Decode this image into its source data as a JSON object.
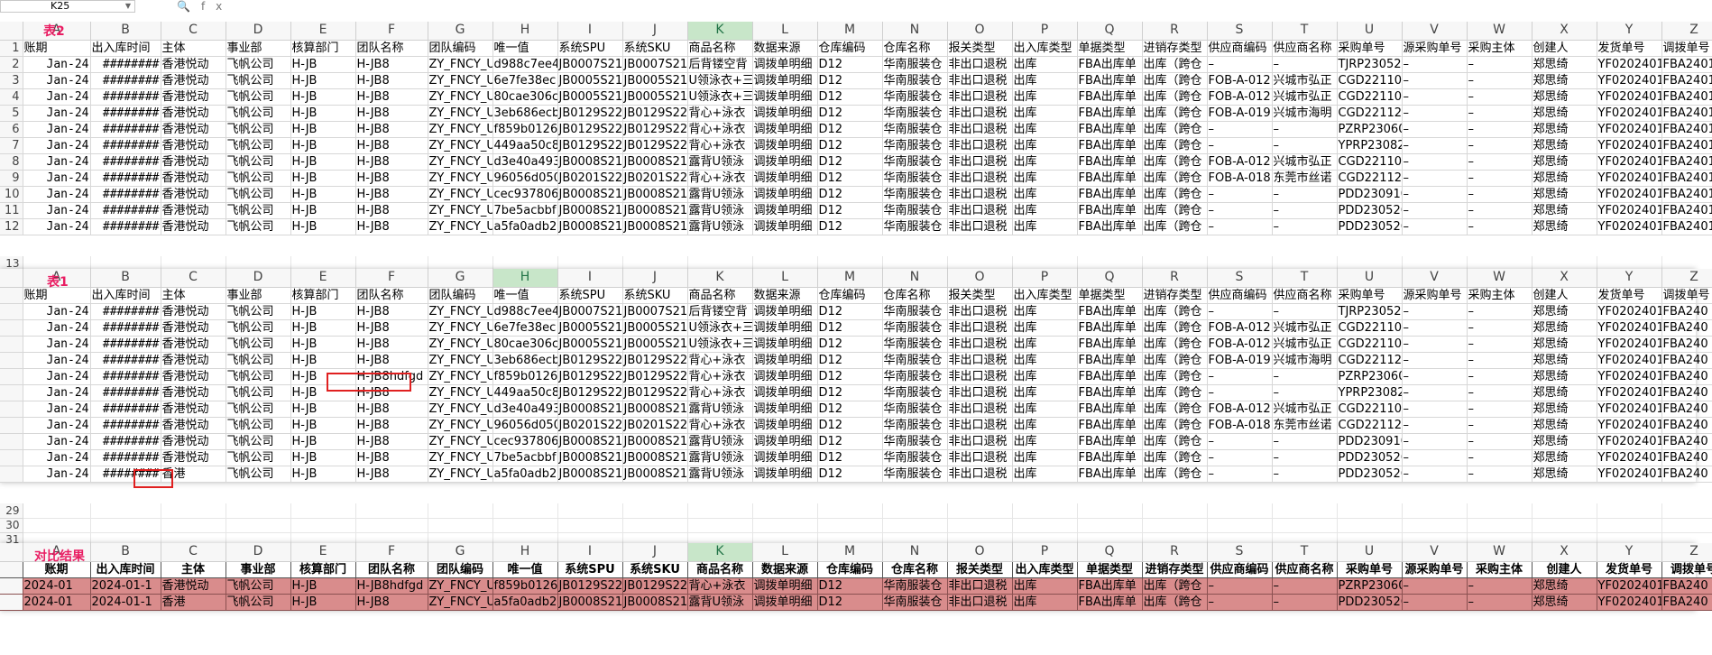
{
  "name_box": "K25",
  "formula_icons": "fx",
  "columns": [
    "A",
    "B",
    "C",
    "D",
    "E",
    "F",
    "G",
    "H",
    "I",
    "J",
    "K",
    "L",
    "M",
    "N",
    "O",
    "P",
    "Q",
    "R",
    "S",
    "T",
    "U",
    "V",
    "W",
    "X",
    "Y",
    "Z"
  ],
  "headers": [
    "账期",
    "出入库时间",
    "主体",
    "事业部",
    "核算部门",
    "团队名称",
    "团队编码",
    "唯一值",
    "系统SPU",
    "系统SKU",
    "商品名称",
    "数据来源",
    "仓库编码",
    "仓库名称",
    "报关类型",
    "出入库类型",
    "单据类型",
    "进销存类型",
    "供应商编码",
    "供应商名称",
    "采购单号",
    "源采购单号",
    "采购主体",
    "创建人",
    "发货单号",
    "调拨单号"
  ],
  "sheet2": {
    "label": "表2",
    "rows": [
      [
        "Jan-24",
        "########",
        "香港悦动",
        "飞帆公司",
        "H-JB",
        "H-JB8",
        "ZY_FNCY_U",
        "d988c7ee4",
        "JB0007S21",
        "JB0007S21",
        "后背镂空背",
        "调拨单明细",
        "D12",
        "华南服装仓",
        "非出口退税",
        "出库",
        "FBA出库单",
        "出库（跨仓",
        "–",
        "–",
        "TJRP23052",
        "–",
        "–",
        "郑思绮",
        "YF0202401",
        "FBA24011"
      ],
      [
        "Jan-24",
        "########",
        "香港悦动",
        "飞帆公司",
        "H-JB",
        "H-JB8",
        "ZY_FNCY_U",
        "6e7fe38ec",
        "JB0005S21",
        "JB0005S21",
        "U领泳衣+三",
        "调拨单明细",
        "D12",
        "华南服装仓",
        "非出口退税",
        "出库",
        "FBA出库单",
        "出库（跨仓",
        "FOB-A-012",
        "兴城市弘正",
        "CGD221103",
        "–",
        "–",
        "郑思绮",
        "YF0202401",
        "FBA24011"
      ],
      [
        "Jan-24",
        "########",
        "香港悦动",
        "飞帆公司",
        "H-JB",
        "H-JB8",
        "ZY_FNCY_U",
        "80cae306c",
        "JB0005S21",
        "JB0005S21",
        "U领泳衣+三",
        "调拨单明细",
        "D12",
        "华南服装仓",
        "非出口退税",
        "出库",
        "FBA出库单",
        "出库（跨仓",
        "FOB-A-012",
        "兴城市弘正",
        "CGD221103",
        "–",
        "–",
        "郑思绮",
        "YF0202401",
        "FBA24011"
      ],
      [
        "Jan-24",
        "########",
        "香港悦动",
        "飞帆公司",
        "H-JB",
        "H-JB8",
        "ZY_FNCY_U",
        "3eb686ecb",
        "JB0129S22",
        "JB0129S22",
        "背心+泳衣",
        "调拨单明细",
        "D12",
        "华南服装仓",
        "非出口退税",
        "出库",
        "FBA出库单",
        "出库（跨仓",
        "FOB-A-019",
        "兴城市海明",
        "CGD221123",
        "–",
        "–",
        "郑思绮",
        "YF0202401",
        "FBA24011"
      ],
      [
        "Jan-24",
        "########",
        "香港悦动",
        "飞帆公司",
        "H-JB",
        "H-JB8",
        "ZY_FNCY_U",
        "f859b0126",
        "JB0129S22",
        "JB0129S22",
        "背心+泳衣",
        "调拨单明细",
        "D12",
        "华南服装仓",
        "非出口退税",
        "出库",
        "FBA出库单",
        "出库（跨仓",
        "–",
        "–",
        "PZRP23060",
        "–",
        "–",
        "郑思绮",
        "YF0202401",
        "FBA24011"
      ],
      [
        "Jan-24",
        "########",
        "香港悦动",
        "飞帆公司",
        "H-JB",
        "H-JB8",
        "ZY_FNCY_U",
        "449aa50c8",
        "JB0129S22",
        "JB0129S22",
        "背心+泳衣",
        "调拨单明细",
        "D12",
        "华南服装仓",
        "非出口退税",
        "出库",
        "FBA出库单",
        "出库（跨仓",
        "–",
        "–",
        "YPRP23082",
        "–",
        "–",
        "郑思绮",
        "YF0202401",
        "FBA24011"
      ],
      [
        "Jan-24",
        "########",
        "香港悦动",
        "飞帆公司",
        "H-JB",
        "H-JB8",
        "ZY_FNCY_U",
        "d3e40a493",
        "JB0008S21",
        "JB0008S21",
        "露背U领泳",
        "调拨单明细",
        "D12",
        "华南服装仓",
        "非出口退税",
        "出库",
        "FBA出库单",
        "出库（跨仓",
        "FOB-A-012",
        "兴城市弘正",
        "CGD221103",
        "–",
        "–",
        "郑思绮",
        "YF0202401",
        "FBA24011"
      ],
      [
        "Jan-24",
        "########",
        "香港悦动",
        "飞帆公司",
        "H-JB",
        "H-JB8",
        "ZY_FNCY_U",
        "96056d050",
        "JB0201S22",
        "JB0201S22",
        "背心+泳衣",
        "调拨单明细",
        "D12",
        "华南服装仓",
        "非出口退税",
        "出库",
        "FBA出库单",
        "出库（跨仓",
        "FOB-A-018",
        "东莞市丝诺",
        "CGD221122",
        "–",
        "–",
        "郑思绮",
        "YF0202401",
        "FBA24011"
      ],
      [
        "Jan-24",
        "########",
        "香港悦动",
        "飞帆公司",
        "H-JB",
        "H-JB8",
        "ZY_FNCY_U",
        "cec937806",
        "JB0008S21",
        "JB0008S21",
        "露背U领泳",
        "调拨单明细",
        "D12",
        "华南服装仓",
        "非出口退税",
        "出库",
        "FBA出库单",
        "出库（跨仓",
        "–",
        "–",
        "PDD230910",
        "–",
        "–",
        "郑思绮",
        "YF0202401",
        "FBA24011"
      ],
      [
        "Jan-24",
        "########",
        "香港悦动",
        "飞帆公司",
        "H-JB",
        "H-JB8",
        "ZY_FNCY_U",
        "7be5acbbf",
        "JB0008S21",
        "JB0008S21",
        "露背U领泳",
        "调拨单明细",
        "D12",
        "华南服装仓",
        "非出口退税",
        "出库",
        "FBA出库单",
        "出库（跨仓",
        "–",
        "–",
        "PDD230526",
        "–",
        "–",
        "郑思绮",
        "YF0202401",
        "FBA24011"
      ],
      [
        "Jan-24",
        "########",
        "香港悦动",
        "飞帆公司",
        "H-JB",
        "H-JB8",
        "ZY_FNCY_U",
        "a5fa0adb2",
        "JB0008S21",
        "JB0008S21",
        "露背U领泳",
        "调拨单明细",
        "D12",
        "华南服装仓",
        "非出口退税",
        "出库",
        "FBA出库单",
        "出库（跨仓",
        "–",
        "–",
        "PDD230526",
        "–",
        "–",
        "郑思绮",
        "YF0202401",
        "FBA24011"
      ]
    ]
  },
  "sheet1": {
    "label": "表1",
    "rows": [
      [
        "Jan-24",
        "########",
        "香港悦动",
        "飞帆公司",
        "H-JB",
        "H-JB8",
        "ZY_FNCY_U",
        "d988c7ee4",
        "JB0007S21",
        "JB0007S21",
        "后背镂空背",
        "调拨单明细",
        "D12",
        "华南服装仓",
        "非出口退税",
        "出库",
        "FBA出库单",
        "出库（跨仓",
        "–",
        "–",
        "TJRP23052",
        "–",
        "–",
        "郑思绮",
        "YF0202401",
        "FBA240"
      ],
      [
        "Jan-24",
        "########",
        "香港悦动",
        "飞帆公司",
        "H-JB",
        "H-JB8",
        "ZY_FNCY_U",
        "6e7fe38ec",
        "JB0005S21",
        "JB0005S21",
        "U领泳衣+三",
        "调拨单明细",
        "D12",
        "华南服装仓",
        "非出口退税",
        "出库",
        "FBA出库单",
        "出库（跨仓",
        "FOB-A-012",
        "兴城市弘正",
        "CGD221103",
        "–",
        "–",
        "郑思绮",
        "YF0202401",
        "FBA240"
      ],
      [
        "Jan-24",
        "########",
        "香港悦动",
        "飞帆公司",
        "H-JB",
        "H-JB8",
        "ZY_FNCY_U",
        "80cae306c",
        "JB0005S21",
        "JB0005S21",
        "U领泳衣+三",
        "调拨单明细",
        "D12",
        "华南服装仓",
        "非出口退税",
        "出库",
        "FBA出库单",
        "出库（跨仓",
        "FOB-A-012",
        "兴城市弘正",
        "CGD221103",
        "–",
        "–",
        "郑思绮",
        "YF0202401",
        "FBA240"
      ],
      [
        "Jan-24",
        "########",
        "香港悦动",
        "飞帆公司",
        "H-JB",
        "H-JB8",
        "ZY_FNCY_U",
        "3eb686ecb",
        "JB0129S22",
        "JB0129S22",
        "背心+泳衣",
        "调拨单明细",
        "D12",
        "华南服装仓",
        "非出口退税",
        "出库",
        "FBA出库单",
        "出库（跨仓",
        "FOB-A-019",
        "兴城市海明",
        "CGD221123",
        "–",
        "–",
        "郑思绮",
        "YF0202401",
        "FBA240"
      ],
      [
        "Jan-24",
        "########",
        "香港悦动",
        "飞帆公司",
        "H-JB",
        "H-JB8hdfgd",
        "ZY_FNCY_U",
        "f859b0126",
        "JB0129S22",
        "JB0129S22",
        "背心+泳衣",
        "调拨单明细",
        "D12",
        "华南服装仓",
        "非出口退税",
        "出库",
        "FBA出库单",
        "出库（跨仓",
        "–",
        "–",
        "PZRP23060",
        "–",
        "–",
        "郑思绮",
        "YF0202401",
        "FBA240"
      ],
      [
        "Jan-24",
        "########",
        "香港悦动",
        "飞帆公司",
        "H-JB",
        "H-JB8",
        "ZY_FNCY_U",
        "449aa50c8",
        "JB0129S22",
        "JB0129S22",
        "背心+泳衣",
        "调拨单明细",
        "D12",
        "华南服装仓",
        "非出口退税",
        "出库",
        "FBA出库单",
        "出库（跨仓",
        "–",
        "–",
        "YPRP23082",
        "–",
        "–",
        "郑思绮",
        "YF0202401",
        "FBA240"
      ],
      [
        "Jan-24",
        "########",
        "香港悦动",
        "飞帆公司",
        "H-JB",
        "H-JB8",
        "ZY_FNCY_U",
        "d3e40a493",
        "JB0008S21",
        "JB0008S21",
        "露背U领泳",
        "调拨单明细",
        "D12",
        "华南服装仓",
        "非出口退税",
        "出库",
        "FBA出库单",
        "出库（跨仓",
        "FOB-A-012",
        "兴城市弘正",
        "CGD221103",
        "–",
        "–",
        "郑思绮",
        "YF0202401",
        "FBA240"
      ],
      [
        "Jan-24",
        "########",
        "香港悦动",
        "飞帆公司",
        "H-JB",
        "H-JB8",
        "ZY_FNCY_U",
        "96056d050",
        "JB0201S22",
        "JB0201S22",
        "背心+泳衣",
        "调拨单明细",
        "D12",
        "华南服装仓",
        "非出口退税",
        "出库",
        "FBA出库单",
        "出库（跨仓",
        "FOB-A-018",
        "东莞市丝诺",
        "CGD221122",
        "–",
        "–",
        "郑思绮",
        "YF0202401",
        "FBA240"
      ],
      [
        "Jan-24",
        "########",
        "香港悦动",
        "飞帆公司",
        "H-JB",
        "H-JB8",
        "ZY_FNCY_U",
        "cec937806",
        "JB0008S21",
        "JB0008S21",
        "露背U领泳",
        "调拨单明细",
        "D12",
        "华南服装仓",
        "非出口退税",
        "出库",
        "FBA出库单",
        "出库（跨仓",
        "–",
        "–",
        "PDD230910",
        "–",
        "–",
        "郑思绮",
        "YF0202401",
        "FBA240"
      ],
      [
        "Jan-24",
        "########",
        "香港悦动",
        "飞帆公司",
        "H-JB",
        "H-JB8",
        "ZY_FNCY_U",
        "7be5acbbf",
        "JB0008S21",
        "JB0008S21",
        "露背U领泳",
        "调拨单明细",
        "D12",
        "华南服装仓",
        "非出口退税",
        "出库",
        "FBA出库单",
        "出库（跨仓",
        "–",
        "–",
        "PDD230526",
        "–",
        "–",
        "郑思绮",
        "YF0202401",
        "FBA240"
      ],
      [
        "Jan-24",
        "########",
        "香港",
        "飞帆公司",
        "H-JB",
        "H-JB8",
        "ZY_FNCY_U",
        "a5fa0adb2",
        "JB0008S21",
        "JB0008S21",
        "露背U领泳",
        "调拨单明细",
        "D12",
        "华南服装仓",
        "非出口退税",
        "出库",
        "FBA出库单",
        "出库（跨仓",
        "–",
        "–",
        "PDD230526",
        "–",
        "–",
        "郑思绮",
        "YF0202401",
        "FBA240"
      ]
    ]
  },
  "result": {
    "label": "对比结果",
    "rows": [
      [
        "2024-01",
        "2024-01-1",
        "香港悦动",
        "飞帆公司",
        "H-JB",
        "H-JB8hdfgd",
        "ZY_FNCY_U",
        "f859b0126",
        "JB0129S22",
        "JB0129S22",
        "背心+泳衣",
        "调拨单明细",
        "D12",
        "华南服装仓",
        "非出口退税",
        "出库",
        "FBA出库单",
        "出库（跨仓",
        "–",
        "–",
        "PZRP23060",
        "–",
        "–",
        "郑思绮",
        "YF0202401",
        "FBA240"
      ],
      [
        "2024-01",
        "2024-01-1",
        "香港",
        "飞帆公司",
        "H-JB",
        "H-JB8",
        "ZY_FNCY_U",
        "a5fa0adb2",
        "JB0008S21",
        "JB0008S21",
        "露背U领泳",
        "调拨单明细",
        "D12",
        "华南服装仓",
        "非出口退税",
        "出库",
        "FBA出库单",
        "出库（跨仓",
        "–",
        "–",
        "PDD230526",
        "–",
        "–",
        "郑思绮",
        "YF0202401",
        "FBA240"
      ]
    ]
  },
  "gap_rows": [
    "13",
    "14"
  ],
  "gap_rows2": [
    "29",
    "30",
    "31"
  ],
  "colors": {
    "accent_green": "#217346",
    "diff_fill": "#d98c8c",
    "highlight_red": "#e02020",
    "tag_pink": "#e91e63"
  }
}
